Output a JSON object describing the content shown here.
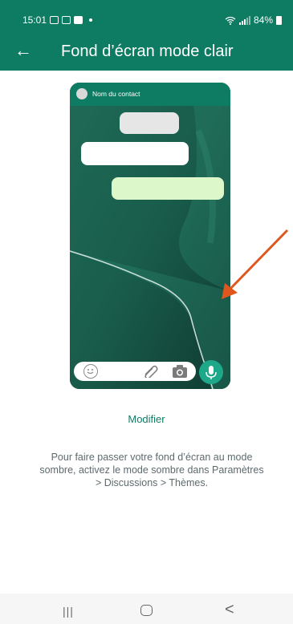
{
  "status_bar": {
    "time": "15:01",
    "battery": "84%",
    "icons": [
      "gallery-icon",
      "gmail-icon",
      "flipboard-icon",
      "wifi-icon",
      "signal-icon",
      "battery-icon"
    ]
  },
  "app_bar": {
    "title": "Fond d’écran mode clair",
    "back_icon": "arrow-left-icon",
    "color": "#0e7b63"
  },
  "preview": {
    "contact_name": "Nom du contact",
    "icons": [
      "emoji-icon",
      "paperclip-icon",
      "camera-icon",
      "microphone-icon"
    ],
    "colors": {
      "incoming_bubble": "#ffffff",
      "outgoing_bubble": "#dcf7c9",
      "mic_button": "#1da88a"
    }
  },
  "annotation": {
    "arrow_color": "#e0571e"
  },
  "actions": {
    "modify_label": "Modifier"
  },
  "info": {
    "text": "Pour faire passer votre fond d’écran au mode sombre, activez le mode sombre dans Paramètres > Discussions > Thèmes."
  },
  "nav_bar": {
    "recent_glyph": "|||",
    "back_glyph": "<"
  }
}
